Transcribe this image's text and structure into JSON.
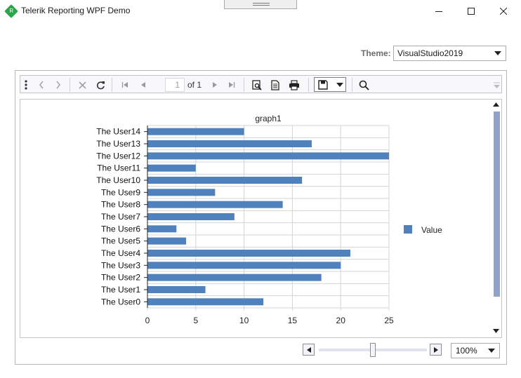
{
  "window": {
    "title": "Telerik Reporting WPF Demo",
    "app_icon_letter": "R",
    "icons": [
      "minimize-icon",
      "maximize-icon",
      "close-icon"
    ]
  },
  "theme": {
    "label": "Theme:",
    "selected": "VisualStudio2019"
  },
  "toolbar": {
    "page_current": "1",
    "page_of": "of 1",
    "icons": [
      "more-icon",
      "back-icon",
      "forward-icon",
      "stop-icon",
      "refresh-icon",
      "first-page-icon",
      "prev-page-icon",
      "next-page-icon",
      "last-page-icon",
      "print-preview-icon",
      "document-map-icon",
      "print-icon",
      "save-icon",
      "save-dropdown-icon",
      "search-icon",
      "toolbar-overflow-icon"
    ]
  },
  "zoom": {
    "value": "100%",
    "slider_level": 0.5
  },
  "colors": {
    "bar": "#4f81bd",
    "accent": "#8fa2cc"
  },
  "chart_data": {
    "type": "bar",
    "orientation": "horizontal",
    "title": "graph1",
    "categories": [
      "The User0",
      "The User1",
      "The User2",
      "The User3",
      "The User4",
      "The User5",
      "The User6",
      "The User7",
      "The User8",
      "The User9",
      "The User10",
      "The User11",
      "The User12",
      "The User13",
      "The User14"
    ],
    "series": [
      {
        "name": "Value",
        "values": [
          12,
          6,
          18,
          20,
          21,
          4,
          3,
          9,
          14,
          7,
          16,
          5,
          25,
          17,
          10
        ]
      }
    ],
    "xlim": [
      0,
      25
    ],
    "xticks": [
      "0",
      "5",
      "10",
      "15",
      "20",
      "25"
    ],
    "grid": true,
    "legend": "right"
  }
}
